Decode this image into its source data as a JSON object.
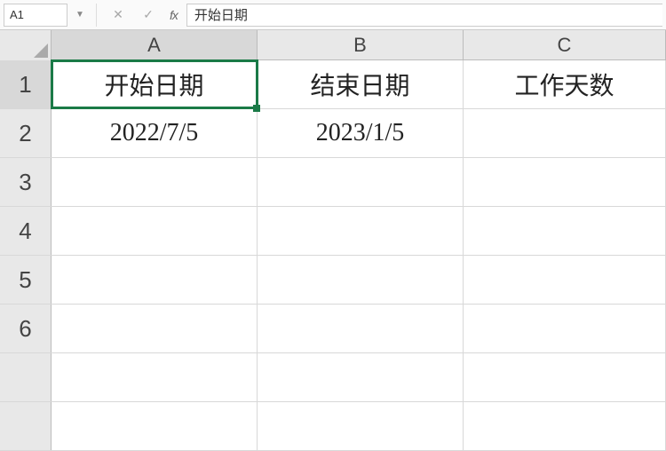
{
  "formula_bar": {
    "name_box": "A1",
    "formula_value": "开始日期"
  },
  "columns": [
    {
      "letter": "A",
      "selected": true
    },
    {
      "letter": "B",
      "selected": false
    },
    {
      "letter": "C",
      "selected": false
    }
  ],
  "rows": [
    {
      "num": "1",
      "selected": true
    },
    {
      "num": "2",
      "selected": false
    },
    {
      "num": "3",
      "selected": false
    },
    {
      "num": "4",
      "selected": false
    },
    {
      "num": "5",
      "selected": false
    },
    {
      "num": "6",
      "selected": false
    }
  ],
  "cells": {
    "A1": "开始日期",
    "B1": "结束日期",
    "C1": "工作天数",
    "A2": "2022/7/5",
    "B2": "2023/1/5",
    "C2": "",
    "A3": "",
    "B3": "",
    "C3": "",
    "A4": "",
    "B4": "",
    "C4": "",
    "A5": "",
    "B5": "",
    "C5": "",
    "A6": "",
    "B6": "",
    "C6": ""
  },
  "selected_cell": "A1"
}
